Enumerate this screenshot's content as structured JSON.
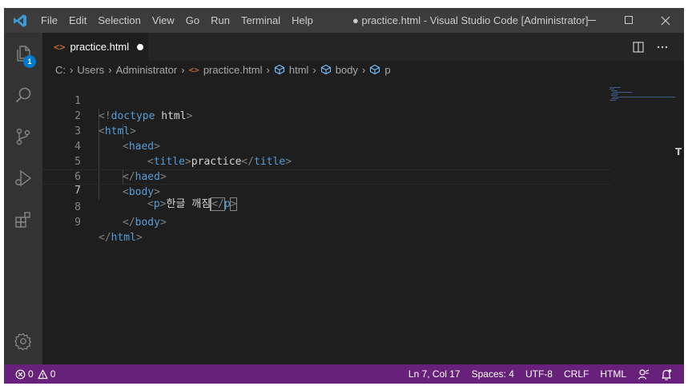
{
  "menu": [
    "File",
    "Edit",
    "Selection",
    "View",
    "Go",
    "Run",
    "Terminal",
    "Help"
  ],
  "window_title": "● practice.html - Visual Studio Code [Administrator]",
  "window_controls": [
    "minimize",
    "maximize",
    "close"
  ],
  "activity": {
    "explorer_badge": "1",
    "icons": [
      "explorer-icon",
      "search-icon",
      "source-control-icon",
      "run-debug-icon",
      "extensions-icon",
      "settings-gear-icon"
    ]
  },
  "tab": {
    "icon": "<>",
    "label": "practice.html"
  },
  "breadcrumb": {
    "drive": "C:",
    "folder1": "Users",
    "folder2": "Administrator",
    "file": "practice.html",
    "sym1": "html",
    "sym2": "body",
    "sym3": "p",
    "separator": "›"
  },
  "editor": {
    "line_numbers": [
      "1",
      "2",
      "3",
      "4",
      "5",
      "6",
      "7",
      "8",
      "9"
    ],
    "current_line": 7,
    "lines": [
      {
        "b1": "<!",
        "tag": "doctype",
        "txt": " html",
        "b2": ">"
      },
      {
        "b1": "<",
        "tag": "html",
        "b2": ">"
      },
      {
        "b1": "<",
        "tag": "haed",
        "b2": ">"
      },
      {
        "b1": "<",
        "tag": "title",
        "b2": ">",
        "txt": "practice",
        "b3": "</",
        "tag2": "title",
        "b4": ">"
      },
      {
        "b1": "</",
        "tag": "haed",
        "b2": ">"
      },
      {
        "b1": "<",
        "tag": "body",
        "b2": ">"
      },
      {
        "b1": "<",
        "tag": "p",
        "b2": ">",
        "txt": "한글 깨짐",
        "b3": "</",
        "tag2": "p",
        "b4": ">"
      },
      {
        "b1": "</",
        "tag": "body",
        "b2": ">"
      },
      {
        "b1": "</",
        "tag": "html",
        "b2": ">"
      }
    ]
  },
  "status": {
    "errors": "0",
    "warnings": "0",
    "position": "Ln 7, Col 17",
    "spaces": "Spaces: 4",
    "encoding": "UTF-8",
    "eol": "CRLF",
    "language": "HTML"
  },
  "colors": {
    "titlebar": "#3c3c3c",
    "activitybar": "#333333",
    "editor_bg": "#1e1e1e",
    "statusbar": "#68217a",
    "tag": "#569cd6",
    "bracket": "#808080",
    "text": "#d4d4d4",
    "badge": "#007acc",
    "file_icon": "#e37933"
  }
}
